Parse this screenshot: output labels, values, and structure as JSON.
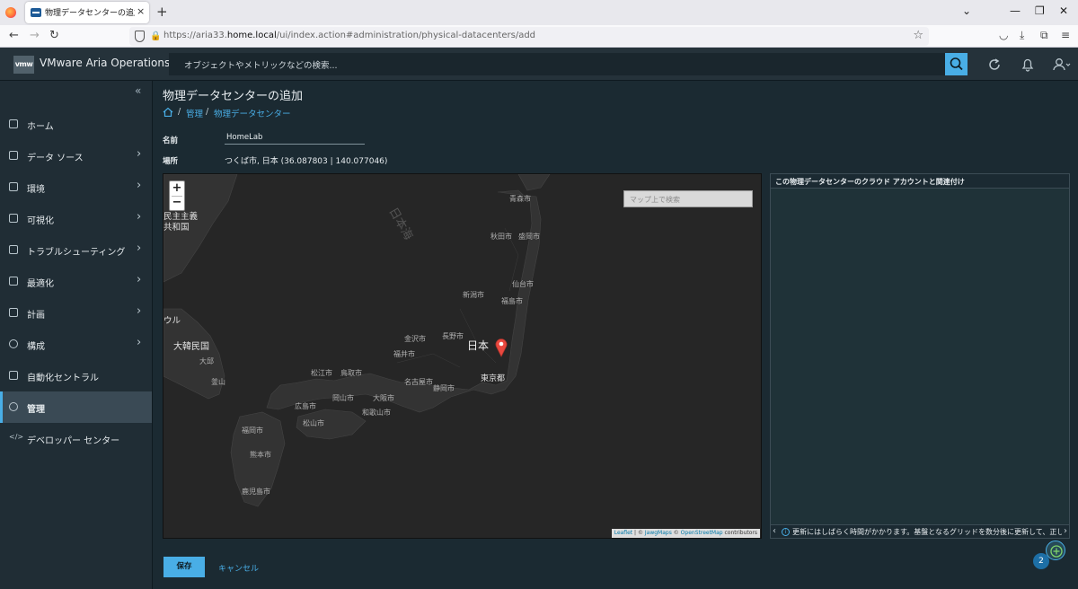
{
  "browser": {
    "tab_title": "物理データセンターの追加 - VMware",
    "tab_close": "×",
    "new_tab": "+",
    "url_prefix": "https://aria33.",
    "url_host": "home.local",
    "url_path": "/ui/index.action#administration/physical-datacenters/add"
  },
  "app": {
    "logo": "vmw",
    "title": "VMware Aria Operations",
    "search_placeholder": "オブジェクトやメトリックなどの検索..."
  },
  "sidebar": {
    "collapse": "«",
    "items": [
      {
        "label": "ホーム",
        "chevron": ""
      },
      {
        "label": "データ ソース",
        "chevron": "›"
      },
      {
        "label": "環境",
        "chevron": "›"
      },
      {
        "label": "可視化",
        "chevron": "›"
      },
      {
        "label": "トラブルシューティング",
        "chevron": "›"
      },
      {
        "label": "最適化",
        "chevron": "›"
      },
      {
        "label": "計画",
        "chevron": "›"
      },
      {
        "label": "構成",
        "chevron": "›"
      },
      {
        "label": "自動化セントラル",
        "chevron": ""
      },
      {
        "label": "管理",
        "chevron": ""
      },
      {
        "label": "デベロッパー センター",
        "chevron": ""
      }
    ]
  },
  "main": {
    "title": "物理データセンターの追加",
    "breadcrumb": {
      "sep": "/",
      "admin": "管理",
      "current": "物理データセンター"
    },
    "name_label": "名前",
    "name_value": "HomeLab",
    "location_label": "場所",
    "location_value": "つくば市, 日本 (36.087803 | 140.077046)"
  },
  "map": {
    "zoom_in": "+",
    "zoom_out": "−",
    "search_placeholder": "マップ上で検索",
    "labels": {
      "aomori": "青森市",
      "akita": "秋田市",
      "morioka": "盛岡市",
      "sendai": "仙台市",
      "niigata": "新潟市",
      "fukushima": "福島市",
      "japan": "日本",
      "nagano": "長野市",
      "kanazawa": "金沢市",
      "fukui": "福井市",
      "tokyo": "東京都",
      "nagoya": "名古屋市",
      "shizuoka": "静岡市",
      "matsue": "松江市",
      "tottori": "鳥取市",
      "okayama": "岡山市",
      "osaka": "大阪市",
      "hiroshima": "広島市",
      "wakayama": "和歌山市",
      "matsuyama": "松山市",
      "fukuoka": "福岡市",
      "kumamoto": "熊本市",
      "kagoshima": "鹿児島市",
      "korea": "大韓民国",
      "daegu": "大邱",
      "busan": "釜山",
      "nk1": "民主主義",
      "nk2": "共和国",
      "sea": "日本海",
      "ru": "ウル"
    },
    "attribution": {
      "leaflet": "Leaflet",
      "sep": " | © ",
      "jawg": "JawgMaps",
      "mid": " © ",
      "osm": "OpenStreetMap",
      "end": " contributors"
    }
  },
  "panel": {
    "title": "この物理データセンターのクラウド アカウントと関連付け",
    "footer": "更新にはしばらく時間がかかります。基盤となるグリッドを数分後に更新して、正しい..."
  },
  "actions": {
    "save": "保存",
    "cancel": "キャンセル"
  },
  "fab": {
    "badge": "2"
  }
}
